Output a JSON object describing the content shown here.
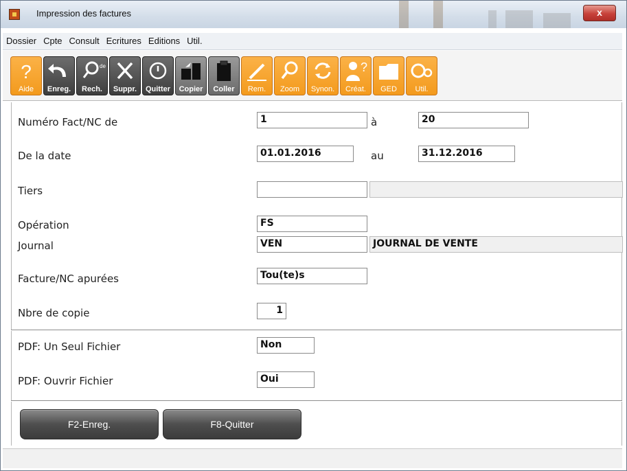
{
  "window": {
    "title": "Impression des factures",
    "close_label": "x"
  },
  "menu": [
    "Dossier",
    "Cpte",
    "Consult",
    "Ecritures",
    "Editions",
    "Util."
  ],
  "toolbar": [
    {
      "label": "Aide",
      "icon": "help-icon",
      "style": "orange"
    },
    {
      "label": "Enreg.",
      "icon": "undo-arrow-icon",
      "style": "gray"
    },
    {
      "label": "Rech.",
      "icon": "search-icon",
      "style": "gray"
    },
    {
      "label": "Suppr.",
      "icon": "delete-x-icon",
      "style": "gray"
    },
    {
      "label": "Quitter",
      "icon": "power-icon",
      "style": "gray"
    },
    {
      "label": "Copier",
      "icon": "copy-icon",
      "style": "light"
    },
    {
      "label": "Coller",
      "icon": "paste-icon",
      "style": "light"
    },
    {
      "label": "Rem.",
      "icon": "pencil-icon",
      "style": "orange"
    },
    {
      "label": "Zoom",
      "icon": "zoom-icon",
      "style": "orange"
    },
    {
      "label": "Synon.",
      "icon": "refresh-icon",
      "style": "orange"
    },
    {
      "label": "Créat.",
      "icon": "user-create-icon",
      "style": "orange"
    },
    {
      "label": "GED",
      "icon": "folder-icon",
      "style": "orange"
    },
    {
      "label": "Util.",
      "icon": "gears-icon",
      "style": "orange"
    }
  ],
  "form": {
    "numero": {
      "label": "Numéro Fact/NC de",
      "from": "1",
      "to_label": "à",
      "to": "20"
    },
    "date": {
      "label": "De la date",
      "from": "01.01.2016",
      "to_label": "au",
      "to": "31.12.2016"
    },
    "tiers": {
      "label": "Tiers",
      "value": "",
      "desc": ""
    },
    "operation": {
      "label": "Opération",
      "value": "FS"
    },
    "journal": {
      "label": "Journal",
      "value": "VEN",
      "desc": "JOURNAL DE VENTE"
    },
    "apurees": {
      "label": "Facture/NC apurées",
      "value": "Tou(te)s"
    },
    "copies": {
      "label": "Nbre de copie",
      "value": "1"
    },
    "pdf_single": {
      "label": "PDF: Un Seul Fichier",
      "value": "Non"
    },
    "pdf_open": {
      "label": "PDF: Ouvrir Fichier",
      "value": "Oui"
    }
  },
  "buttons": {
    "save": "F2-Enreg.",
    "quit": "F8-Quitter"
  },
  "colors": {
    "orange": "#f7a631",
    "dark": "#4a4a4a",
    "accent_close": "#c7413a"
  }
}
